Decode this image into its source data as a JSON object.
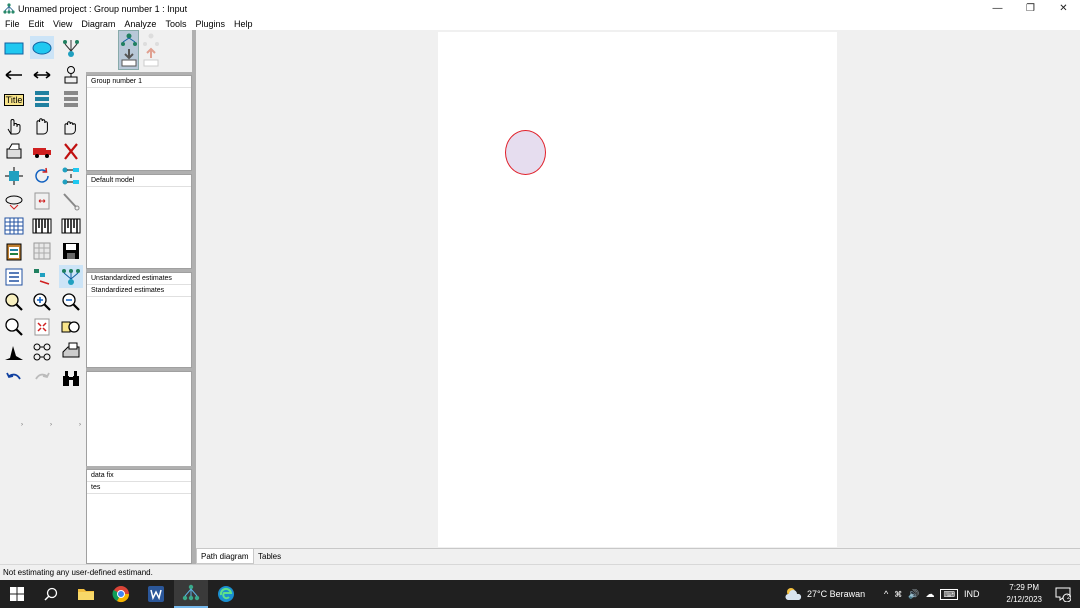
{
  "window": {
    "title": "Unnamed project : Group number 1 : Input",
    "controls": {
      "minimize": "—",
      "restore": "❐",
      "close": "✕"
    }
  },
  "menu": [
    "File",
    "Edit",
    "View",
    "Diagram",
    "Analyze",
    "Tools",
    "Plugins",
    "Help"
  ],
  "toolbox": {
    "title_tool_label": "Title",
    "active_tool": "draw-latent-tool"
  },
  "panels": {
    "groups": [
      "Group number 1"
    ],
    "models": [
      "Default model"
    ],
    "parameter_formats": [
      "Unstandardized estimates",
      "Standardized estimates"
    ],
    "computation_summary": [],
    "files": [
      "data fix",
      "tes"
    ]
  },
  "diagram": {
    "latent_variable": {
      "border_color": "#e0202a",
      "fill_color": "#e6ddef"
    }
  },
  "tabs": [
    "Path diagram",
    "Tables"
  ],
  "active_tab": "Path diagram",
  "status": "Not estimating any user-defined estimand.",
  "taskbar": {
    "weather": "27°C  Berawan",
    "language": "IND",
    "time": "7:29 PM",
    "date": "2/12/2023",
    "notifications": "2"
  }
}
